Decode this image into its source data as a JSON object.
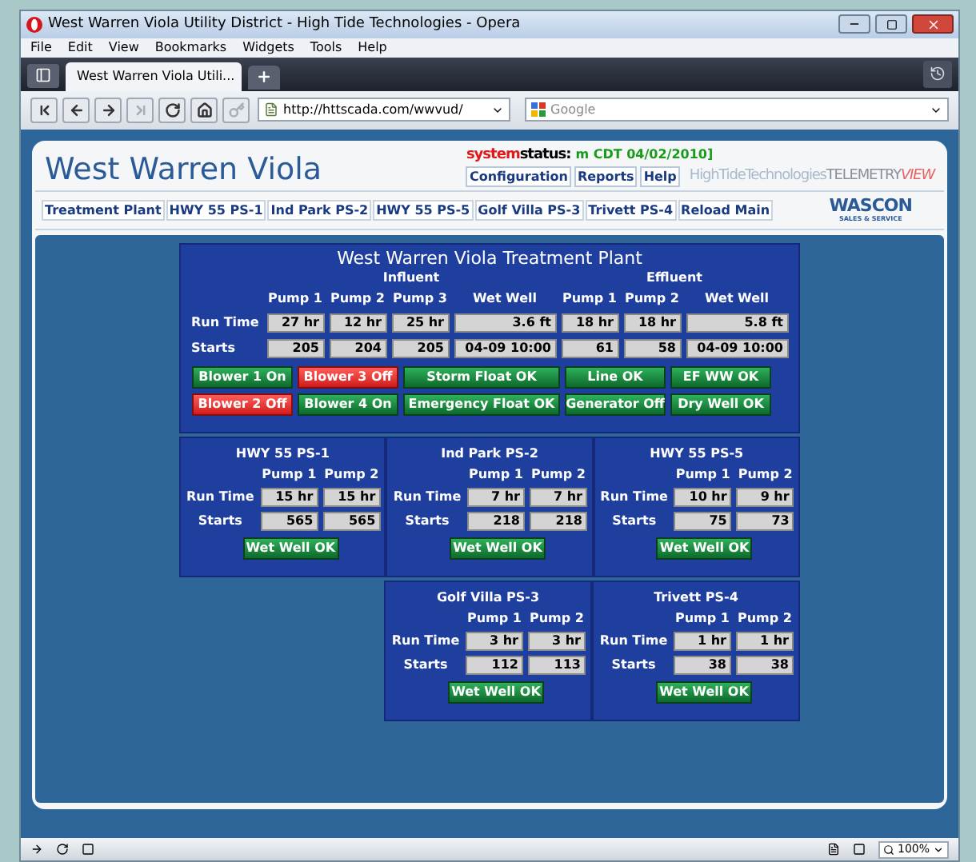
{
  "browser": {
    "title": "West Warren Viola Utility District - High Tide Technologies - Opera",
    "menu": [
      "File",
      "Edit",
      "View",
      "Bookmarks",
      "Widgets",
      "Tools",
      "Help"
    ],
    "tab": {
      "label": "West Warren Viola Utili...",
      "selected": true
    },
    "url": "http://httscada.com/wwvud/",
    "search": {
      "placeholder": "Google"
    },
    "zoom": "100%"
  },
  "header": {
    "title": "West Warren Viola",
    "status": {
      "prefix": "system",
      "label": "status:",
      "value": "m CDT 04/02/2010]"
    },
    "links": [
      "Configuration",
      "Reports",
      "Help"
    ],
    "brand": {
      "first": "HighTideTechnologies",
      "second": "TELEMETRY",
      "third": "VIEW"
    },
    "nav": [
      "Treatment Plant",
      "HWY 55 PS-1",
      "Ind Park PS-2",
      "HWY 55 PS-5",
      "Golf Villa PS-3",
      "Trivett PS-4",
      "Reload Main"
    ],
    "logo": {
      "name": "WASCON",
      "tagline": "SALES & SERVICE"
    }
  },
  "plant": {
    "title": "West Warren Viola Treatment Plant",
    "groups": [
      {
        "label": "Influent",
        "columns": [
          {
            "label": "Pump 1",
            "kind": "pump"
          },
          {
            "label": "Pump 2",
            "kind": "pump"
          },
          {
            "label": "Pump 3",
            "kind": "pump"
          },
          {
            "label": "Wet Well",
            "kind": "well"
          }
        ]
      },
      {
        "label": "Effluent",
        "columns": [
          {
            "label": "Pump 1",
            "kind": "pump"
          },
          {
            "label": "Pump 2",
            "kind": "pump"
          },
          {
            "label": "Wet Well",
            "kind": "well"
          }
        ]
      }
    ],
    "rows": [
      {
        "label": "Run Time",
        "values": [
          "27 hr",
          "12 hr",
          "25 hr",
          "3.6 ft",
          "18 hr",
          "18 hr",
          "5.8 ft"
        ]
      },
      {
        "label": "Starts",
        "values": [
          "205",
          "204",
          "205",
          "04-09 10:00",
          "61",
          "58",
          "04-09 10:00"
        ]
      }
    ],
    "indicators": [
      [
        {
          "label": "Blower 1 On",
          "alarm": false
        },
        {
          "label": "Blower 3 Off",
          "alarm": true
        },
        {
          "label": "Storm Float OK",
          "alarm": false
        },
        {
          "label": "Line OK",
          "alarm": false
        },
        {
          "label": "EF WW OK",
          "alarm": false
        }
      ],
      [
        {
          "label": "Blower 2 Off",
          "alarm": true
        },
        {
          "label": "Blower 4 On",
          "alarm": false
        },
        {
          "label": "Emergency Float OK",
          "alarm": false
        },
        {
          "label": "Generator Off",
          "alarm": false
        },
        {
          "label": "Dry Well OK",
          "alarm": false
        }
      ]
    ]
  },
  "stations": [
    [
      {
        "title": "HWY 55 PS-1",
        "pumps": [
          "Pump 1",
          "Pump 2"
        ],
        "rows": [
          {
            "label": "Run Time",
            "values": [
              "15 hr",
              "15 hr"
            ]
          },
          {
            "label": "Starts",
            "values": [
              "565",
              "565"
            ]
          }
        ],
        "status": {
          "label": "Wet Well OK",
          "alarm": false
        }
      },
      {
        "title": "Ind Park PS-2",
        "pumps": [
          "Pump 1",
          "Pump 2"
        ],
        "rows": [
          {
            "label": "Run Time",
            "values": [
              "7 hr",
              "7 hr"
            ]
          },
          {
            "label": "Starts",
            "values": [
              "218",
              "218"
            ]
          }
        ],
        "status": {
          "label": "Wet Well OK",
          "alarm": false
        }
      },
      {
        "title": "HWY 55 PS-5",
        "pumps": [
          "Pump 1",
          "Pump 2"
        ],
        "rows": [
          {
            "label": "Run Time",
            "values": [
              "10 hr",
              "9 hr"
            ]
          },
          {
            "label": "Starts",
            "values": [
              "75",
              "73"
            ]
          }
        ],
        "status": {
          "label": "Wet Well OK",
          "alarm": false
        }
      }
    ],
    [
      {
        "title": "Golf Villa PS-3",
        "pumps": [
          "Pump 1",
          "Pump 2"
        ],
        "rows": [
          {
            "label": "Run Time",
            "values": [
              "3 hr",
              "3 hr"
            ]
          },
          {
            "label": "Starts",
            "values": [
              "112",
              "113"
            ]
          }
        ],
        "status": {
          "label": "Wet Well OK",
          "alarm": false
        }
      },
      {
        "title": "Trivett PS-4",
        "pumps": [
          "Pump 1",
          "Pump 2"
        ],
        "rows": [
          {
            "label": "Run Time",
            "values": [
              "1 hr",
              "1 hr"
            ]
          },
          {
            "label": "Starts",
            "values": [
              "38",
              "38"
            ]
          }
        ],
        "status": {
          "label": "Wet Well OK",
          "alarm": false
        }
      }
    ]
  ]
}
